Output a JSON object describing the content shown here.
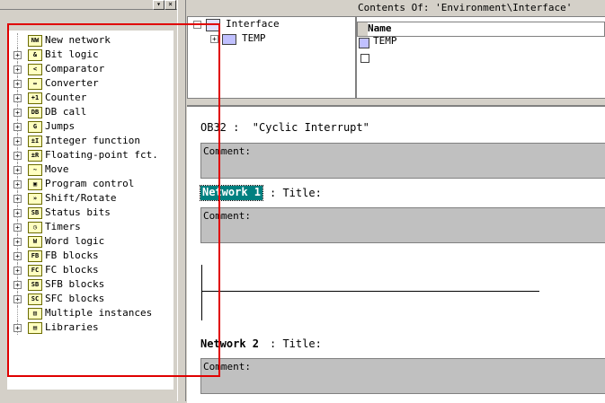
{
  "catalog": {
    "items": [
      {
        "label": "New network",
        "icon": "new-network-icon",
        "glyph": "NW",
        "expandable": false
      },
      {
        "label": "Bit logic",
        "icon": "bit-logic-icon",
        "glyph": "&",
        "expandable": true
      },
      {
        "label": "Comparator",
        "icon": "comparator-icon",
        "glyph": "<",
        "expandable": true
      },
      {
        "label": "Converter",
        "icon": "converter-icon",
        "glyph": "↔",
        "expandable": true
      },
      {
        "label": "Counter",
        "icon": "counter-icon",
        "glyph": "+1",
        "expandable": true
      },
      {
        "label": "DB call",
        "icon": "db-call-icon",
        "glyph": "DB",
        "expandable": true
      },
      {
        "label": "Jumps",
        "icon": "jumps-icon",
        "glyph": "G",
        "expandable": true
      },
      {
        "label": "Integer function",
        "icon": "integer-function-icon",
        "glyph": "±I",
        "expandable": true
      },
      {
        "label": "Floating-point fct.",
        "icon": "floating-point-icon",
        "glyph": "±R",
        "expandable": true
      },
      {
        "label": "Move",
        "icon": "move-icon",
        "glyph": "~",
        "expandable": true
      },
      {
        "label": "Program control",
        "icon": "program-control-icon",
        "glyph": "▣",
        "expandable": true
      },
      {
        "label": "Shift/Rotate",
        "icon": "shift-rotate-icon",
        "glyph": "»",
        "expandable": true
      },
      {
        "label": "Status bits",
        "icon": "status-bits-icon",
        "glyph": "SB",
        "expandable": true
      },
      {
        "label": "Timers",
        "icon": "timers-icon",
        "glyph": "◷",
        "expandable": true
      },
      {
        "label": "Word logic",
        "icon": "word-logic-icon",
        "glyph": "W",
        "expandable": true
      },
      {
        "label": "FB blocks",
        "icon": "fb-blocks-icon",
        "glyph": "FB",
        "expandable": true
      },
      {
        "label": "FC blocks",
        "icon": "fc-blocks-icon",
        "glyph": "FC",
        "expandable": true
      },
      {
        "label": "SFB blocks",
        "icon": "sfb-blocks-icon",
        "glyph": "SB",
        "expandable": true
      },
      {
        "label": "SFC blocks",
        "icon": "sfc-blocks-icon",
        "glyph": "SC",
        "expandable": true
      },
      {
        "label": "Multiple instances",
        "icon": "multiple-instances-icon",
        "glyph": "▥",
        "expandable": false
      },
      {
        "label": "Libraries",
        "icon": "libraries-icon",
        "glyph": "▤",
        "expandable": true
      }
    ]
  },
  "interface_tree": {
    "root": "Interface",
    "child": "TEMP"
  },
  "contents": {
    "title": "Contents Of: 'Environment\\Interface'",
    "column_name": "Name",
    "rows": [
      "TEMP"
    ]
  },
  "editor": {
    "block_title": "OB32 :  \"Cyclic Interrupt\"",
    "comment_label": "Comment:",
    "networks": [
      {
        "label": "Network 1",
        "title": ": Title:"
      },
      {
        "label": "Network 2",
        "title": ": Title:"
      }
    ]
  },
  "colors": {
    "highlight": "#e00000",
    "network_selected": "#008080"
  }
}
